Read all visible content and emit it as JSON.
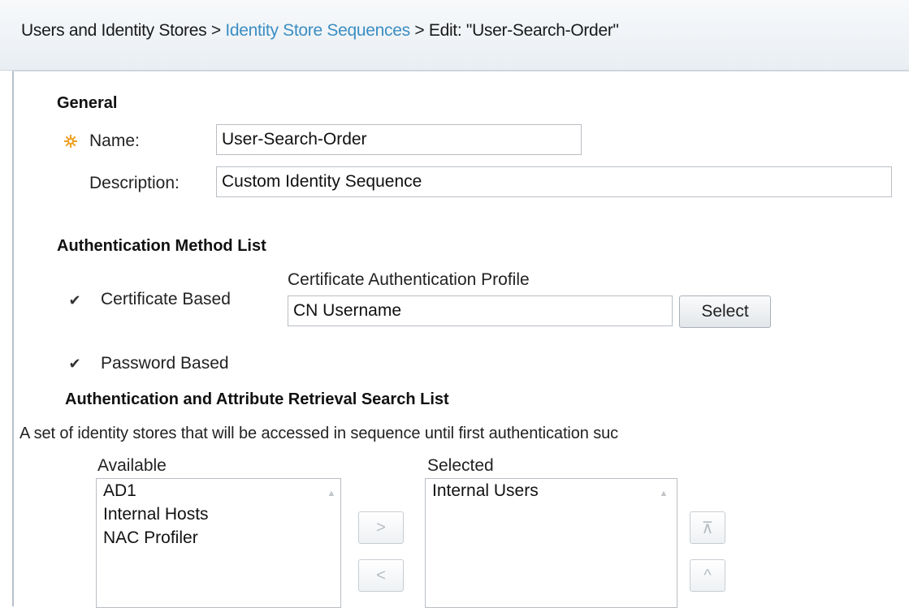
{
  "breadcrumb": {
    "root": "Users and Identity Stores",
    "separator": ">",
    "link": "Identity Store Sequences",
    "current": "Edit: \"User-Search-Order\""
  },
  "general": {
    "title": "General",
    "name_label": "Name:",
    "name_value": "User-Search-Order",
    "description_label": "Description:",
    "description_value": "Custom Identity Sequence"
  },
  "auth_method": {
    "title": "Authentication Method List",
    "certificate_checked": true,
    "certificate_label": "Certificate Based",
    "profile_label": "Certificate Authentication Profile",
    "profile_value": "CN Username",
    "select_button": "Select",
    "password_checked": true,
    "password_label": "Password Based"
  },
  "search_list": {
    "title": "Authentication and Attribute Retrieval Search List",
    "description": "A set of identity stores that will be accessed in sequence until first authentication suc",
    "available_label": "Available",
    "available_items": [
      "AD1",
      "Internal Hosts",
      "NAC Profiler"
    ],
    "selected_label": "Selected",
    "selected_items": [
      "Internal Users"
    ],
    "move_right_glyph": ">",
    "move_left_glyph": "<",
    "move_top_glyph": "⊼",
    "move_up_glyph": "^"
  },
  "colors": {
    "link": "#3b8ec3",
    "required_icon": "#f0a020"
  },
  "icons": {
    "required": "required-asterisk-icon",
    "checkbox": "checkmark-icon"
  }
}
